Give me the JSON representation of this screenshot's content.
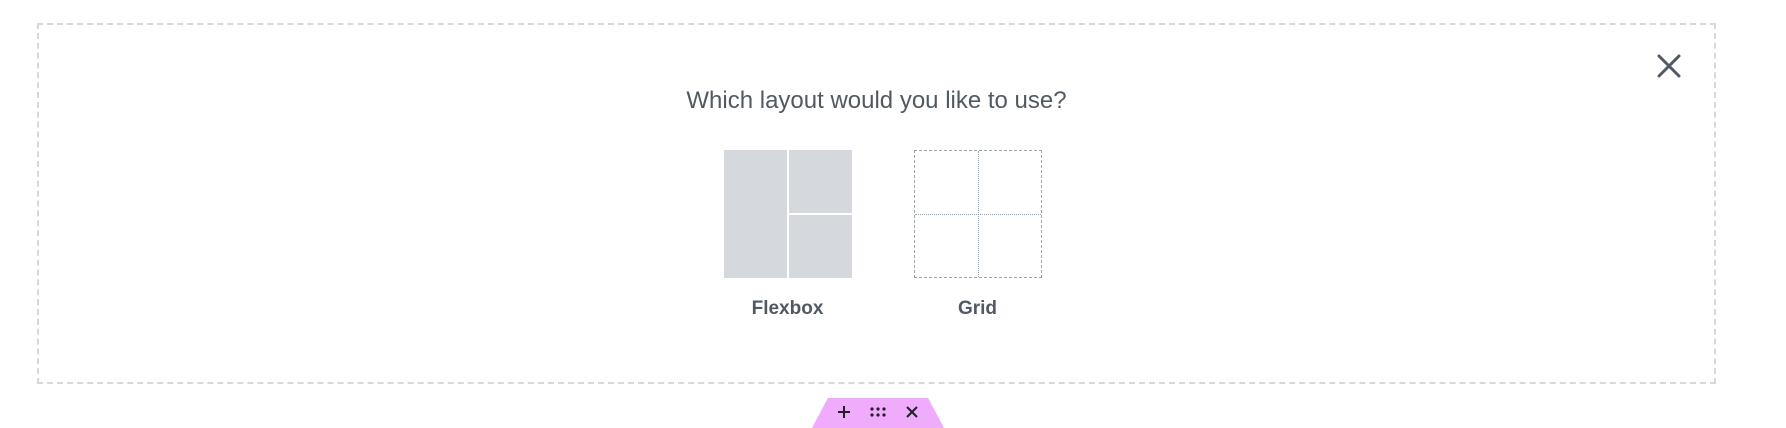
{
  "layout_picker": {
    "title": "Which layout would you like to use?",
    "close_icon": "close-icon",
    "options": [
      {
        "label": "Flexbox",
        "icon": "flexbox-layout-icon"
      },
      {
        "label": "Grid",
        "icon": "grid-layout-icon"
      }
    ]
  },
  "section_handle": {
    "color": "#f0abfc",
    "buttons": [
      {
        "icon": "plus-icon"
      },
      {
        "icon": "drag-handle-icon"
      },
      {
        "icon": "close-icon"
      }
    ]
  },
  "colors": {
    "text": "#515962",
    "preview_fill": "#d5d8dc",
    "dashed_border": "#d5d8dc"
  }
}
